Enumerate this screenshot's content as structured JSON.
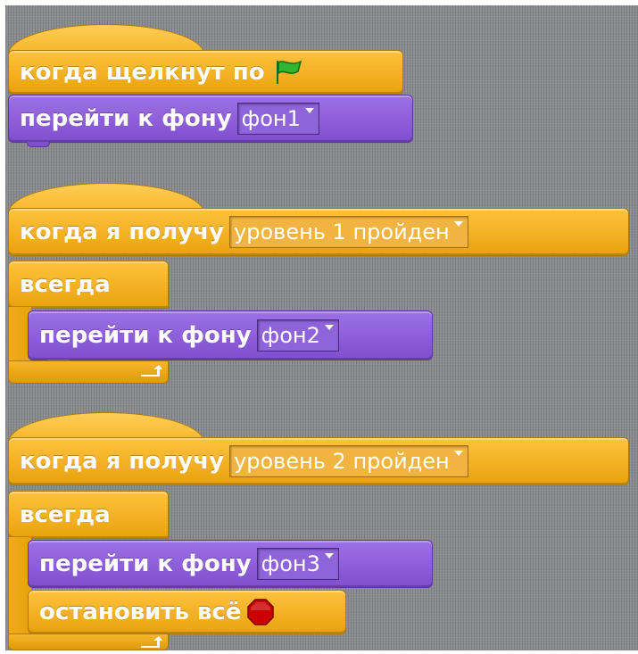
{
  "scripts": [
    {
      "hat": {
        "text": "когда щелкнут по",
        "icon": "green-flag-icon"
      },
      "body": [
        {
          "text": "перейти к фону",
          "dropdown": "фон1"
        }
      ]
    },
    {
      "hat": {
        "text": "когда я получу",
        "dropdown": "уровень 1 пройден"
      },
      "loop": {
        "label": "всегда",
        "icon": "loop-arrow-icon"
      },
      "body": [
        {
          "text": "перейти к фону",
          "dropdown": "фон2"
        }
      ]
    },
    {
      "hat": {
        "text": "когда я получу",
        "dropdown": "уровень 2 пройден"
      },
      "loop": {
        "label": "всегда",
        "icon": "loop-arrow-icon"
      },
      "body": [
        {
          "text": "перейти к фону",
          "dropdown": "фон3"
        },
        {
          "text": "остановить всё",
          "icon": "stop-sign-icon"
        }
      ]
    }
  ],
  "colors": {
    "events": "#e8a20c",
    "looks": "#8f63d9",
    "control": "#e8a20c",
    "flag": "#2fb52f",
    "stop": "#cc0000"
  }
}
